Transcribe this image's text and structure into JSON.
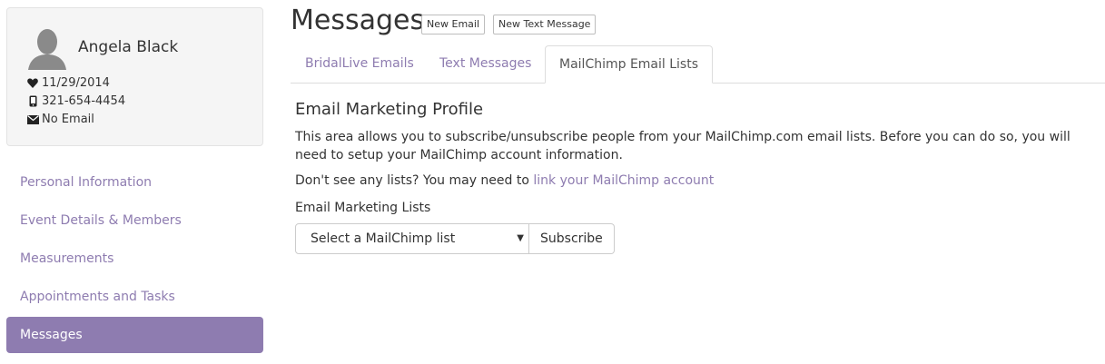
{
  "profile": {
    "name": "Angela Black",
    "event_date": "11/29/2014",
    "phone": "321-654-4454",
    "email": "No Email",
    "icons": {
      "date": "heart-icon",
      "phone": "mobile-phone-icon",
      "email": "envelope-icon",
      "avatar": "person-silhouette-icon"
    }
  },
  "nav": {
    "items": [
      {
        "label": "Personal Information",
        "active": false
      },
      {
        "label": "Event Details & Members",
        "active": false
      },
      {
        "label": "Measurements",
        "active": false
      },
      {
        "label": "Appointments and Tasks",
        "active": false
      },
      {
        "label": "Messages",
        "active": true
      }
    ]
  },
  "header": {
    "title": "Messages",
    "new_email_label": "New Email",
    "new_text_label": "New Text Message"
  },
  "tabs": [
    {
      "label": "BridalLive Emails",
      "active": false
    },
    {
      "label": "Text Messages",
      "active": false
    },
    {
      "label": "MailChimp Email Lists",
      "active": true
    }
  ],
  "content": {
    "title": "Email Marketing Profile",
    "description": "This area allows you to subscribe/unsubscribe people from your MailChimp.com email lists. Before you can do so, you will need to setup your MailChimp account information.",
    "hint_prefix": "Don't see any lists? You may need to ",
    "hint_link": "link your MailChimp account",
    "lists_label": "Email Marketing Lists",
    "select_value": "Select a MailChimp list",
    "subscribe_label": "Subscribe"
  },
  "colors": {
    "accent": "#8e7cb0",
    "card_bg": "#f5f5f5",
    "text": "#333333"
  }
}
